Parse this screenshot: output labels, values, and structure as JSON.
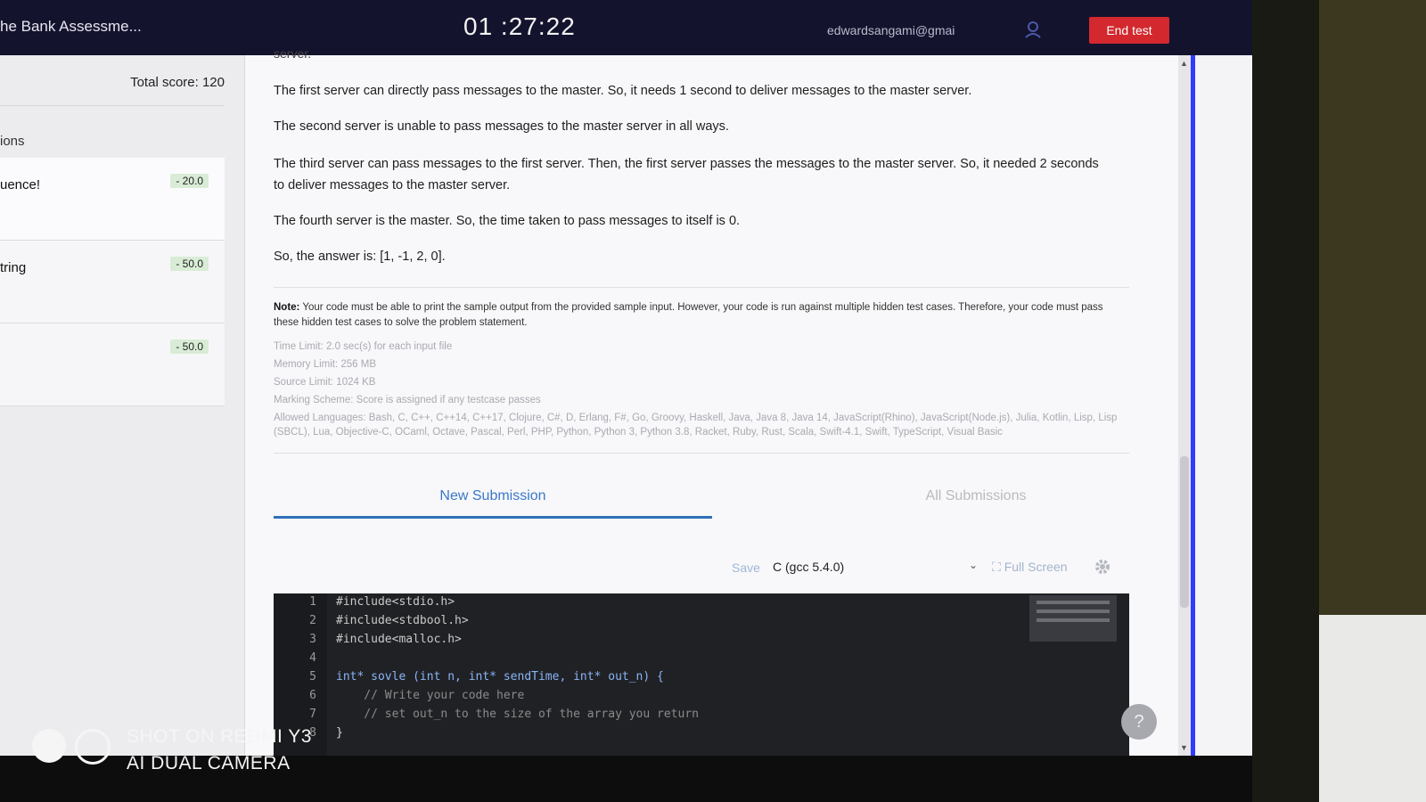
{
  "topbar": {
    "app_title": "he Bank Assessme...",
    "timer": "01 :27:22",
    "user_email": "edwardsangami@gmai",
    "end_test_label": "End test"
  },
  "sidebar": {
    "total_score": "Total score: 120",
    "section_label": "ions",
    "items": [
      {
        "label": "uence!",
        "score": "- 20.0"
      },
      {
        "label": "tring",
        "score": "- 50.0"
      },
      {
        "label": "",
        "score": "- 50.0"
      }
    ]
  },
  "problem": {
    "clipped_word": "server.",
    "paragraphs": [
      "The first server can directly pass messages to the master. So, it needs 1 second to deliver messages to the master server.",
      "The second server is unable to pass messages to the master server in all ways.",
      "The third server can pass messages to the first server. Then, the first server passes the messages to the master server. So, it needed 2 seconds to deliver messages to the master server.",
      "The fourth server is the master. So, the time taken to pass messages to itself is 0.",
      "So, the answer is: [1, -1, 2, 0]."
    ],
    "note_label": "Note:",
    "note_text": "Your code must be able to print the sample output from the provided sample input. However, your code is run against multiple hidden test cases. Therefore, your code must pass these hidden test cases to solve the problem statement.",
    "time_limit": "Time Limit: 2.0 sec(s) for each input file",
    "memory_limit": "Memory Limit: 256 MB",
    "source_limit": "Source Limit: 1024 KB",
    "marking_scheme": "Marking Scheme: Score is assigned if any testcase passes",
    "allowed_languages": "Allowed Languages: Bash, C, C++, C++14, C++17, Clojure, C#, D, Erlang, F#, Go, Groovy, Haskell, Java, Java 8, Java 14, JavaScript(Rhino), JavaScript(Node.js), Julia, Kotlin, Lisp, Lisp (SBCL), Lua, Objective-C, OCaml, Octave, Pascal, Perl, PHP, Python, Python 3, Python 3.8, Racket, Ruby, Rust, Scala, Swift-4.1, Swift, TypeScript, Visual Basic"
  },
  "tabs": {
    "new_submission": "New Submission",
    "all_submissions": "All Submissions"
  },
  "toolbar": {
    "save_label": "Save",
    "language": "C (gcc 5.4.0)",
    "fullscreen_label": "Full Screen"
  },
  "editor": {
    "lines": [
      {
        "n": "1",
        "code": "#include<stdio.h>"
      },
      {
        "n": "2",
        "code": "#include<stdbool.h>"
      },
      {
        "n": "3",
        "code": "#include<malloc.h>"
      },
      {
        "n": "4",
        "code": ""
      },
      {
        "n": "5",
        "code": "int* sovle (int n, int* sendTime, int* out_n) {"
      },
      {
        "n": "6",
        "code": "    // Write your code here"
      },
      {
        "n": "7",
        "code": "    // set out_n to the size of the array you return"
      },
      {
        "n": "8",
        "code": "}"
      }
    ]
  },
  "watermark": {
    "line1": "SHOT ON REDMI Y3",
    "line2": "AI DUAL CAMERA"
  },
  "colors": {
    "topbar_bg": "#14132e",
    "end_test_bg": "#d2282e",
    "accent_blue": "#2f6fb8",
    "score_badge_bg": "#d9ecd6",
    "editor_bg": "#202124"
  }
}
